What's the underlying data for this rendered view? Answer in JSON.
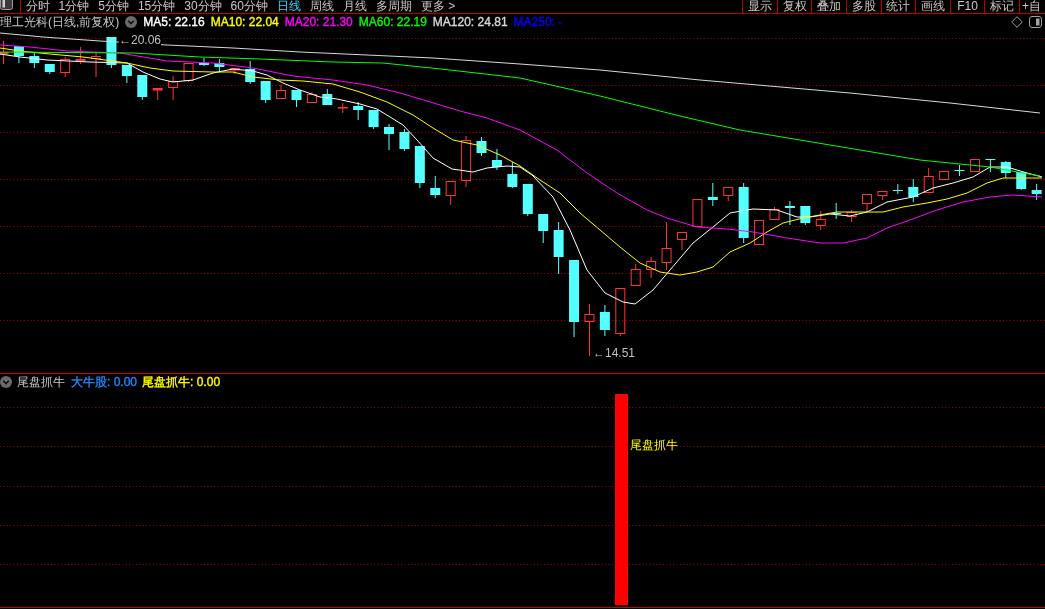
{
  "toolbar": {
    "periods": [
      {
        "label": "分时",
        "selected": false
      },
      {
        "label": "1分钟",
        "selected": false
      },
      {
        "label": "5分钟",
        "selected": false
      },
      {
        "label": "15分钟",
        "selected": false
      },
      {
        "label": "30分钟",
        "selected": false
      },
      {
        "label": "60分钟",
        "selected": false
      },
      {
        "label": "日线",
        "selected": true
      },
      {
        "label": "周线",
        "selected": false
      },
      {
        "label": "月线",
        "selected": false
      },
      {
        "label": "多周期",
        "selected": false
      },
      {
        "label": "更多 >",
        "selected": false
      }
    ],
    "buttons": [
      "显示",
      "复权",
      "叠加",
      "多股",
      "统计",
      "画线",
      "F10",
      "标记",
      "+自"
    ]
  },
  "legend": {
    "title": "理工光科(日线,前复权)",
    "indicators": [
      {
        "label": "MA5: 22.16",
        "color": "#ffffff"
      },
      {
        "label": "MA10: 22.04",
        "color": "#ffff00"
      },
      {
        "label": "MA20: 21.30",
        "color": "#ff00ff"
      },
      {
        "label": "MA60: 22.19",
        "color": "#00ff00"
      },
      {
        "label": "MA120: 24.81",
        "color": "#d8d8d8"
      },
      {
        "label": "MA250: -",
        "color": "#0000ff"
      }
    ]
  },
  "price_chart": {
    "high_label": "←20.06",
    "low_label": "←14.51"
  },
  "indicator_panel": {
    "name": "尾盘抓牛",
    "values": [
      {
        "label": "大牛股: 0.00",
        "color": "#2088ff"
      },
      {
        "label": "尾盘抓牛: 0.00",
        "color": "#ffff00"
      }
    ],
    "signal_label": "尾盘抓牛"
  }
}
